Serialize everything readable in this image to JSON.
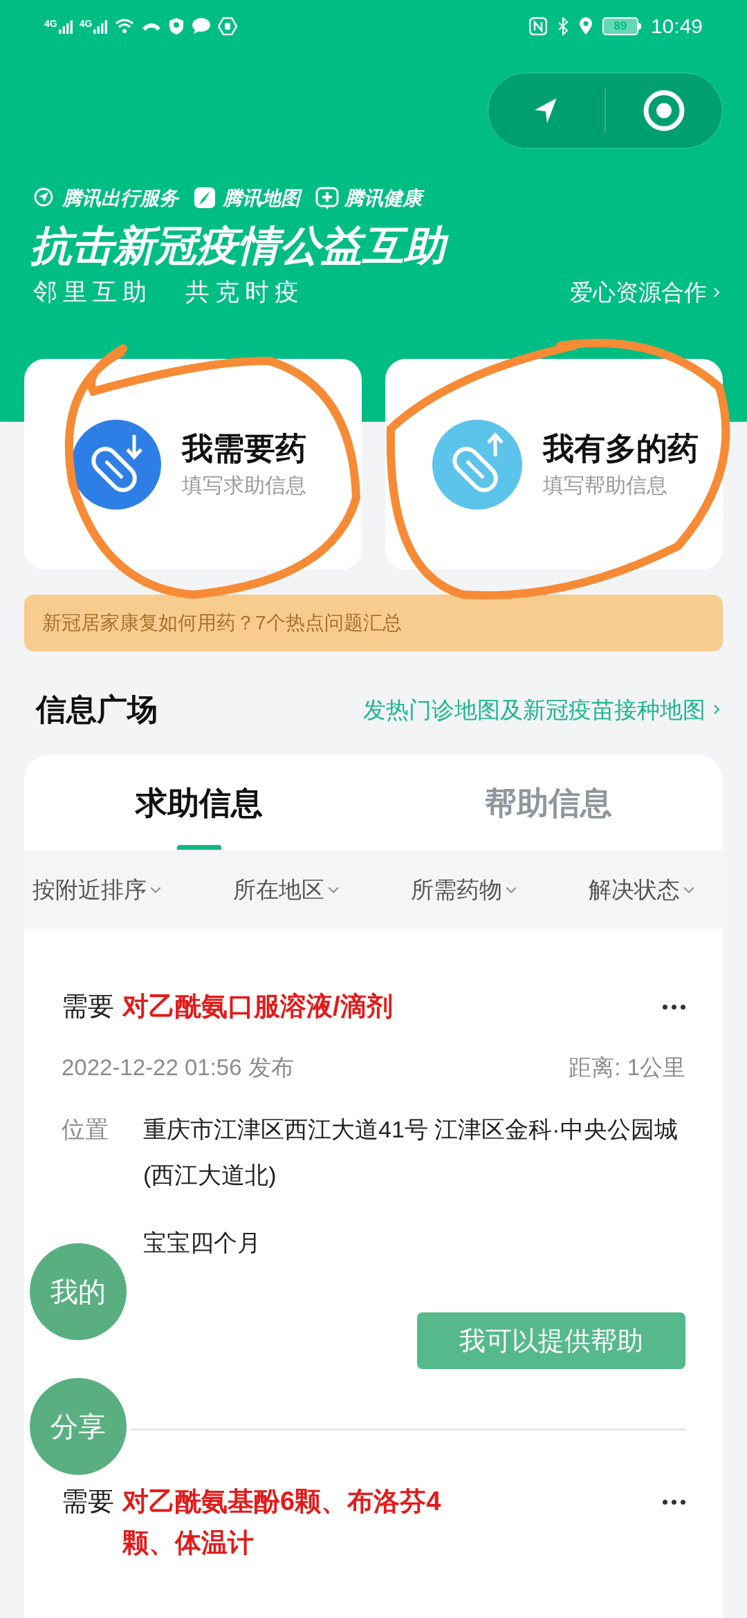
{
  "status_bar": {
    "network_1": "4G",
    "network_2": "4G",
    "battery": "89",
    "time": "10:49"
  },
  "brands": [
    {
      "label": "腾讯出行服务",
      "kind": "travel"
    },
    {
      "label": "腾讯地图",
      "kind": "map"
    },
    {
      "label": "腾讯健康",
      "kind": "health"
    }
  ],
  "title": "抗击新冠疫情公益互助",
  "subtitle": [
    "邻里互助",
    "共克时疫"
  ],
  "partner_link": "爱心资源合作",
  "actions": [
    {
      "title": "我需要药",
      "hint": "填写求助信息",
      "kind": "need"
    },
    {
      "title": "我有多的药",
      "hint": "填写帮助信息",
      "kind": "offer"
    }
  ],
  "banner": "新冠居家康复如何用药？7个热点问题汇总",
  "section": {
    "title": "信息广场",
    "link": "发热门诊地图及新冠疫苗接种地图"
  },
  "tabs": [
    {
      "label": "求助信息",
      "selected": true
    },
    {
      "label": "帮助信息",
      "selected": false
    }
  ],
  "filters": [
    "按附近排序",
    "所在地区",
    "所需药物",
    "解决状态"
  ],
  "posts": [
    {
      "prefix": "需要",
      "medicine": "对乙酰氨口服溶液/滴剂",
      "time": "2022-12-22 01:56 发布",
      "distance": "距离: 1公里",
      "fields": [
        {
          "label": "位置",
          "value": "重庆市江津区西江大道41号 江津区金科·中央公园城(西江大道北)"
        },
        {
          "value": "宝宝四个月"
        }
      ],
      "action": "我可以提供帮助"
    },
    {
      "prefix": "需要",
      "medicine": "对乙酰氨基酚6颗、布洛芬4颗、体温计"
    }
  ],
  "floating_buttons": [
    "我的",
    "分享"
  ]
}
